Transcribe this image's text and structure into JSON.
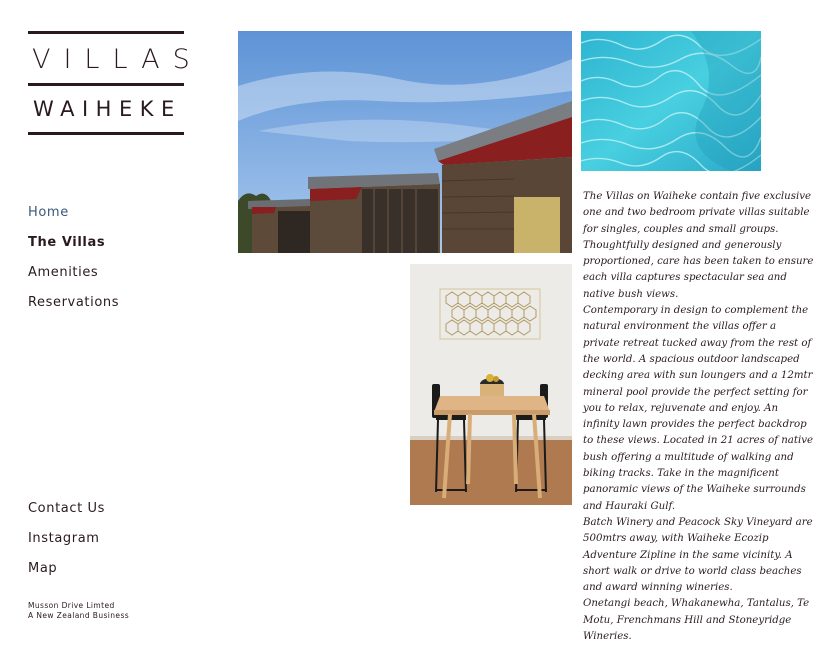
{
  "logo": {
    "line1": "VILLAS",
    "line2": "WAIHEKE"
  },
  "nav": {
    "home": "Home",
    "villas": "The Villas",
    "amenities": "Amenities",
    "reservations": "Reservations"
  },
  "footer_nav": {
    "contact": "Contact Us",
    "instagram": "Instagram",
    "map": "Map"
  },
  "legal": {
    "company": "Musson Drive Limted",
    "tagline": "A New Zealand Business"
  },
  "description": {
    "p1": "The Villas on Waiheke contain five exclusive one and two bedroom private villas suitable for singles, couples and small groups. Thoughtfully designed and generously proportioned, care has been taken to ensure each villa captures spectacular sea and native bush views.",
    "p2": "Contemporary in design to complement the natural environment the villas offer a private retreat tucked away from the rest of the world. A spacious outdoor landscaped decking area with sun loungers and a 12mtr mineral pool provide the perfect setting for you to relax, rejuvenate and enjoy. An infinity lawn provides the perfect backdrop to these views. Located in 21 acres of native bush offering a multitude of walking and biking tracks. Take in the magnificent panoramic views of the Waiheke surrounds and Hauraki Gulf.",
    "p3": "Batch Winery and Peacock Sky Vineyard are 500mtrs away, with Waiheke Ecozip Adventure Zipline in the same vicinity. A short walk or drive to world class beaches and award winning wineries.",
    "p4": "Onetangi beach, Whakanewha, Tantalus, Te Motu, Frenchmans Hill and Stoneyridge Wineries."
  },
  "colors": {
    "text": "#2a1a1f",
    "link_home": "#3a5a7a",
    "roof_red": "#8a1f1f",
    "sky": "#6e9fd8",
    "pool": "#3fc6dc"
  }
}
